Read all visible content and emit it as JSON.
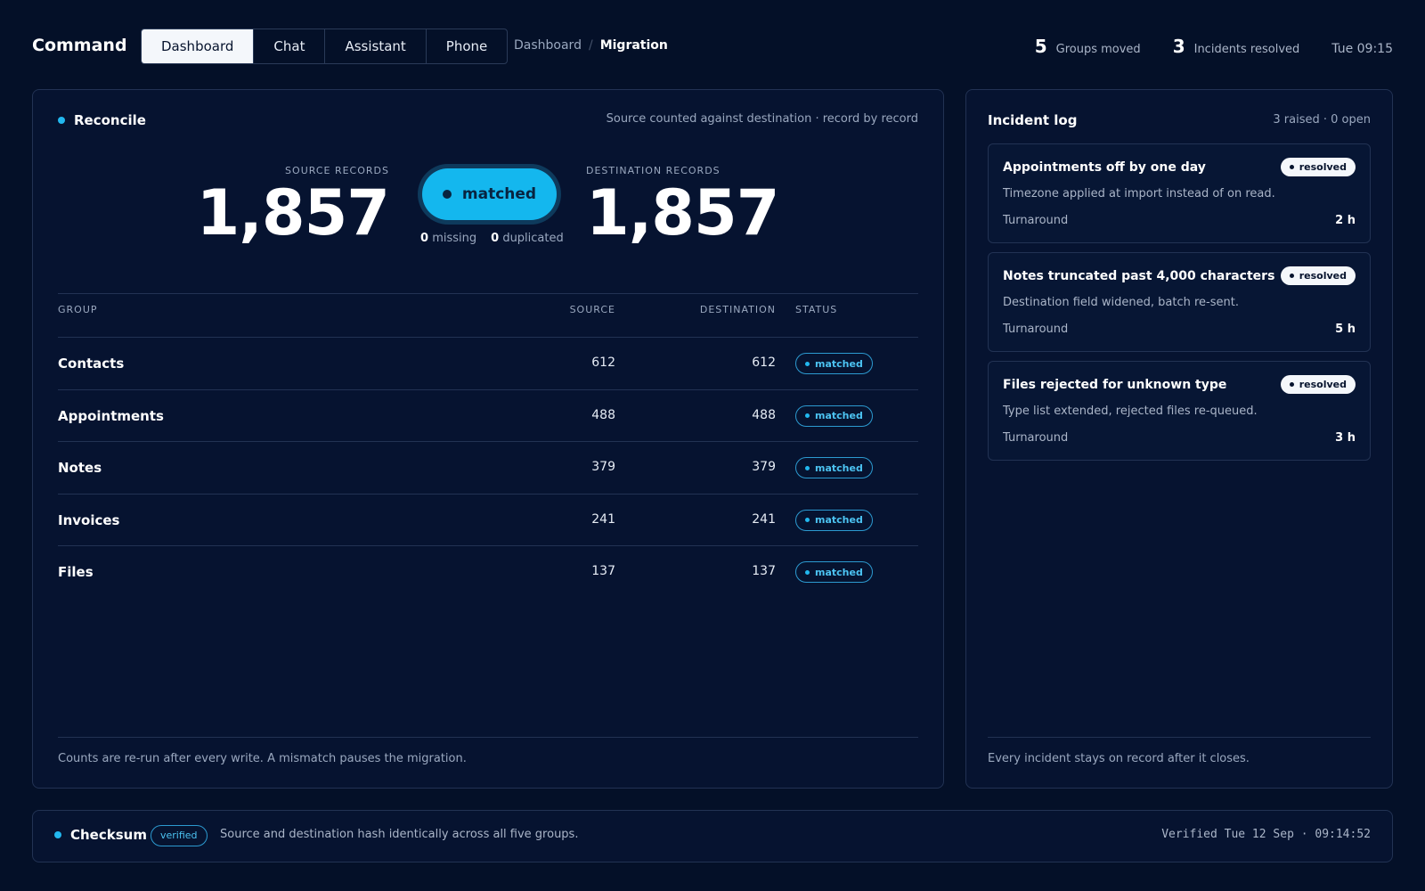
{
  "app": {
    "name": "Command"
  },
  "tabs": [
    {
      "label": "Dashboard",
      "active": true
    },
    {
      "label": "Chat",
      "active": false
    },
    {
      "label": "Assistant",
      "active": false
    },
    {
      "label": "Phone",
      "active": false
    }
  ],
  "breadcrumb": {
    "parent": "Dashboard",
    "separator": "/",
    "current": "Migration"
  },
  "header_stats": [
    {
      "value": "5",
      "label": "Groups moved"
    },
    {
      "value": "3",
      "label": "Incidents resolved"
    }
  ],
  "clock": "Tue 09:15",
  "reconcile": {
    "title": "Reconcile",
    "subtitle": "Source counted against destination · record by record",
    "source_label": "SOURCE RECORDS",
    "source_total": "1,857",
    "destination_label": "DESTINATION RECORDS",
    "destination_total": "1,857",
    "status": "matched",
    "missing_count": "0",
    "missing_label": "missing",
    "duplicated_count": "0",
    "duplicated_label": "duplicated",
    "columns": {
      "group": "GROUP",
      "source": "SOURCE",
      "destination": "DESTINATION",
      "status": "STATUS"
    },
    "rows": [
      {
        "group": "Contacts",
        "source": "612",
        "destination": "612",
        "status": "matched"
      },
      {
        "group": "Appointments",
        "source": "488",
        "destination": "488",
        "status": "matched"
      },
      {
        "group": "Notes",
        "source": "379",
        "destination": "379",
        "status": "matched"
      },
      {
        "group": "Invoices",
        "source": "241",
        "destination": "241",
        "status": "matched"
      },
      {
        "group": "Files",
        "source": "137",
        "destination": "137",
        "status": "matched"
      }
    ],
    "footer": "Counts are re-run after every write. A mismatch pauses the migration."
  },
  "incidents": {
    "title": "Incident log",
    "meta": "3 raised · 0 open",
    "items": [
      {
        "title": "Appointments off by one day",
        "status": "resolved",
        "detail": "Timezone applied at import instead of on read.",
        "turnaround_label": "Turnaround",
        "turnaround": "2 h"
      },
      {
        "title": "Notes truncated past 4,000 characters",
        "status": "resolved",
        "detail": "Destination field widened, batch re-sent.",
        "turnaround_label": "Turnaround",
        "turnaround": "5 h"
      },
      {
        "title": "Files rejected for unknown type",
        "status": "resolved",
        "detail": "Type list extended, rejected files re-queued.",
        "turnaround_label": "Turnaround",
        "turnaround": "3 h"
      }
    ],
    "footer": "Every incident stays on record after it closes."
  },
  "checksum": {
    "title": "Checksum",
    "badge": "verified",
    "description": "Source and destination hash identically across all five groups.",
    "verified_at": "Verified Tue 12 Sep · 09:14:52"
  },
  "colors": {
    "background": "#041028",
    "accent": "#14b7ee",
    "border": "#223253"
  }
}
